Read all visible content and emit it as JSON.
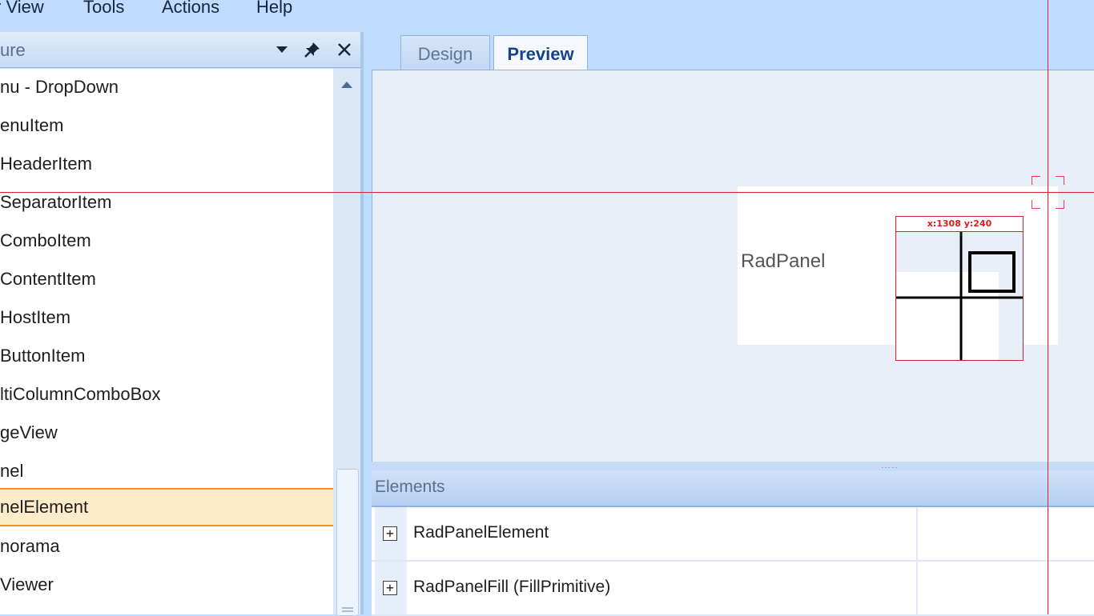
{
  "menubar": {
    "items": [
      "r View",
      "Tools",
      "Actions",
      "Help"
    ]
  },
  "tool_window": {
    "title": "ure",
    "icons": [
      "dropdown-arrow-icon",
      "pin-icon",
      "close-icon"
    ],
    "items": [
      "nu - DropDown",
      "enuItem",
      "HeaderItem",
      "SeparatorItem",
      "ComboItem",
      "ContentItem",
      "HostItem",
      "ButtonItem",
      "ltiColumnComboBox",
      "geView",
      "nel",
      "nelElement",
      "norama",
      "Viewer"
    ],
    "selected_index": 11
  },
  "tabs": {
    "design": "Design",
    "preview": "Preview",
    "active": "preview"
  },
  "preview": {
    "panel_label": "RadPanel"
  },
  "inspector": {
    "readout": "x:1308  y:240",
    "accent": "#d9232a"
  },
  "elements": {
    "title": "Elements",
    "rows": [
      {
        "expander": "+",
        "label": "RadPanelElement"
      },
      {
        "expander": "+",
        "label": "RadPanelFill (FillPrimitive)"
      }
    ]
  }
}
